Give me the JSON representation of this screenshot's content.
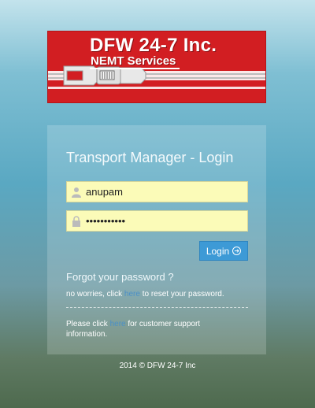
{
  "logo": {
    "title": "DFW 24-7 Inc.",
    "subtitle": "NEMT Services"
  },
  "login": {
    "title": "Transport Manager - Login",
    "username_value": "anupam",
    "password_value": "•••••••••••",
    "button_label": "Login",
    "username_icon": "user-icon",
    "password_icon": "lock-icon"
  },
  "forgot": {
    "title": "Forgot your password ?",
    "text_before": "no worries, click ",
    "link_text": "here",
    "text_after": " to reset your password."
  },
  "support": {
    "text_before": "Please click ",
    "link_text": "here",
    "text_after": " for customer support information."
  },
  "footer": {
    "text": "2014 © DFW 24-7 Inc"
  },
  "colors": {
    "brand_red": "#d21e22",
    "button_blue": "#3d9ad6",
    "field_yellow": "#fbfbb8"
  }
}
